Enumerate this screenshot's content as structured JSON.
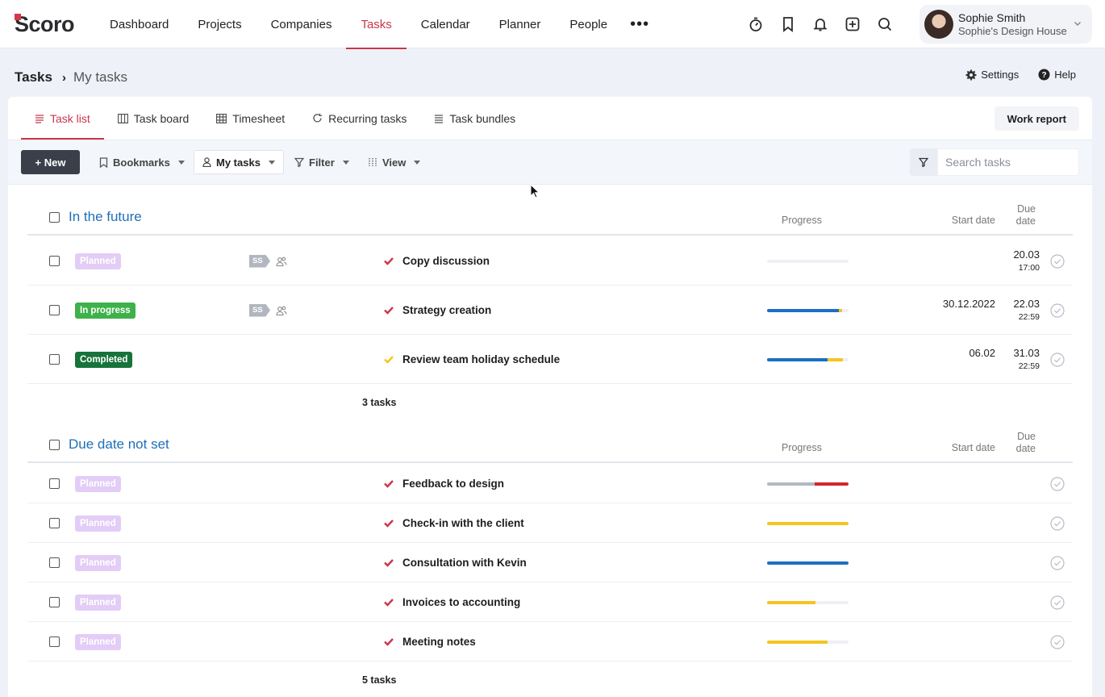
{
  "brand": {
    "logo_text": "Scoro",
    "accent": "#c9364a"
  },
  "nav": {
    "items": [
      {
        "label": "Dashboard"
      },
      {
        "label": "Projects"
      },
      {
        "label": "Companies"
      },
      {
        "label": "Tasks",
        "active": true
      },
      {
        "label": "Calendar"
      },
      {
        "label": "Planner"
      },
      {
        "label": "People"
      }
    ],
    "more_label": "•••",
    "icons": [
      "timer-icon",
      "bookmark-icon",
      "bell-icon",
      "add-icon",
      "search-icon"
    ]
  },
  "user": {
    "name": "Sophie Smith",
    "company": "Sophie's Design House"
  },
  "breadcrumb": {
    "root": "Tasks",
    "separator": "›",
    "current": "My tasks"
  },
  "header_links": {
    "settings": "Settings",
    "help": "Help"
  },
  "tabs": [
    {
      "label": "Task list",
      "icon": "list-icon",
      "active": true
    },
    {
      "label": "Task board",
      "icon": "board-icon"
    },
    {
      "label": "Timesheet",
      "icon": "grid-icon"
    },
    {
      "label": "Recurring tasks",
      "icon": "refresh-icon"
    },
    {
      "label": "Task bundles",
      "icon": "bundle-icon"
    }
  ],
  "work_report_label": "Work report",
  "toolbar": {
    "new_label": "+ New",
    "bookmarks_label": "Bookmarks",
    "my_tasks_label": "My tasks",
    "filter_label": "Filter",
    "view_label": "View",
    "search_placeholder": "Search tasks"
  },
  "columns": {
    "progress": "Progress",
    "start_date": "Start date",
    "due_date_line1": "Due",
    "due_date_line2": "date"
  },
  "status_colors": {
    "planned": "#e3cdf6",
    "in_progress": "#3eb14a",
    "completed": "#17733a"
  },
  "groups": [
    {
      "title": "In the future",
      "count_label": "3 tasks",
      "tasks": [
        {
          "status": "Planned",
          "status_key": "planned",
          "assignee": "SS",
          "priority_color": "#c9364a",
          "name": "Copy discussion",
          "progress": [],
          "start_date": "",
          "due_date": "20.03",
          "due_time": "17:00"
        },
        {
          "status": "In progress",
          "status_key": "progress",
          "assignee": "SS",
          "priority_color": "#c9364a",
          "name": "Strategy creation",
          "progress": [
            {
              "color": "#1b6fc4",
              "fraction": 0.88
            },
            {
              "color": "#f4c51f",
              "fraction": 0.04
            }
          ],
          "start_date": "30.12.2022",
          "due_date": "22.03",
          "due_time": "22:59"
        },
        {
          "status": "Completed",
          "status_key": "completed",
          "assignee": "",
          "priority_color": "#f4c51f",
          "name": "Review team holiday schedule",
          "progress": [
            {
              "color": "#1b6fc4",
              "fraction": 0.74
            },
            {
              "color": "#f4c51f",
              "fraction": 0.19
            }
          ],
          "start_date": "06.02",
          "due_date": "31.03",
          "due_time": "22:59"
        }
      ]
    },
    {
      "title": "Due date not set",
      "count_label": "5 tasks",
      "tasks": [
        {
          "status": "Planned",
          "status_key": "planned",
          "assignee": "",
          "priority_color": "#c9364a",
          "name": "Feedback to design",
          "progress": [
            {
              "color": "#b3b8c1",
              "fraction": 0.58
            },
            {
              "color": "#d3262f",
              "fraction": 0.42
            }
          ],
          "start_date": "",
          "due_date": "",
          "due_time": ""
        },
        {
          "status": "Planned",
          "status_key": "planned",
          "assignee": "",
          "priority_color": "#c9364a",
          "name": "Check-in with the client",
          "progress": [
            {
              "color": "#f4c51f",
              "fraction": 1.0
            }
          ],
          "start_date": "",
          "due_date": "",
          "due_time": ""
        },
        {
          "status": "Planned",
          "status_key": "planned",
          "assignee": "",
          "priority_color": "#c9364a",
          "name": "Consultation with Kevin",
          "progress": [
            {
              "color": "#1b6fc4",
              "fraction": 1.0
            }
          ],
          "start_date": "",
          "due_date": "",
          "due_time": ""
        },
        {
          "status": "Planned",
          "status_key": "planned",
          "assignee": "",
          "priority_color": "#c9364a",
          "name": "Invoices to accounting",
          "progress": [
            {
              "color": "#f4c51f",
              "fraction": 0.59
            }
          ],
          "start_date": "",
          "due_date": "",
          "due_time": ""
        },
        {
          "status": "Planned",
          "status_key": "planned",
          "assignee": "",
          "priority_color": "#c9364a",
          "name": "Meeting notes",
          "progress": [
            {
              "color": "#f4c51f",
              "fraction": 0.74
            }
          ],
          "start_date": "",
          "due_date": "",
          "due_time": ""
        }
      ]
    }
  ]
}
